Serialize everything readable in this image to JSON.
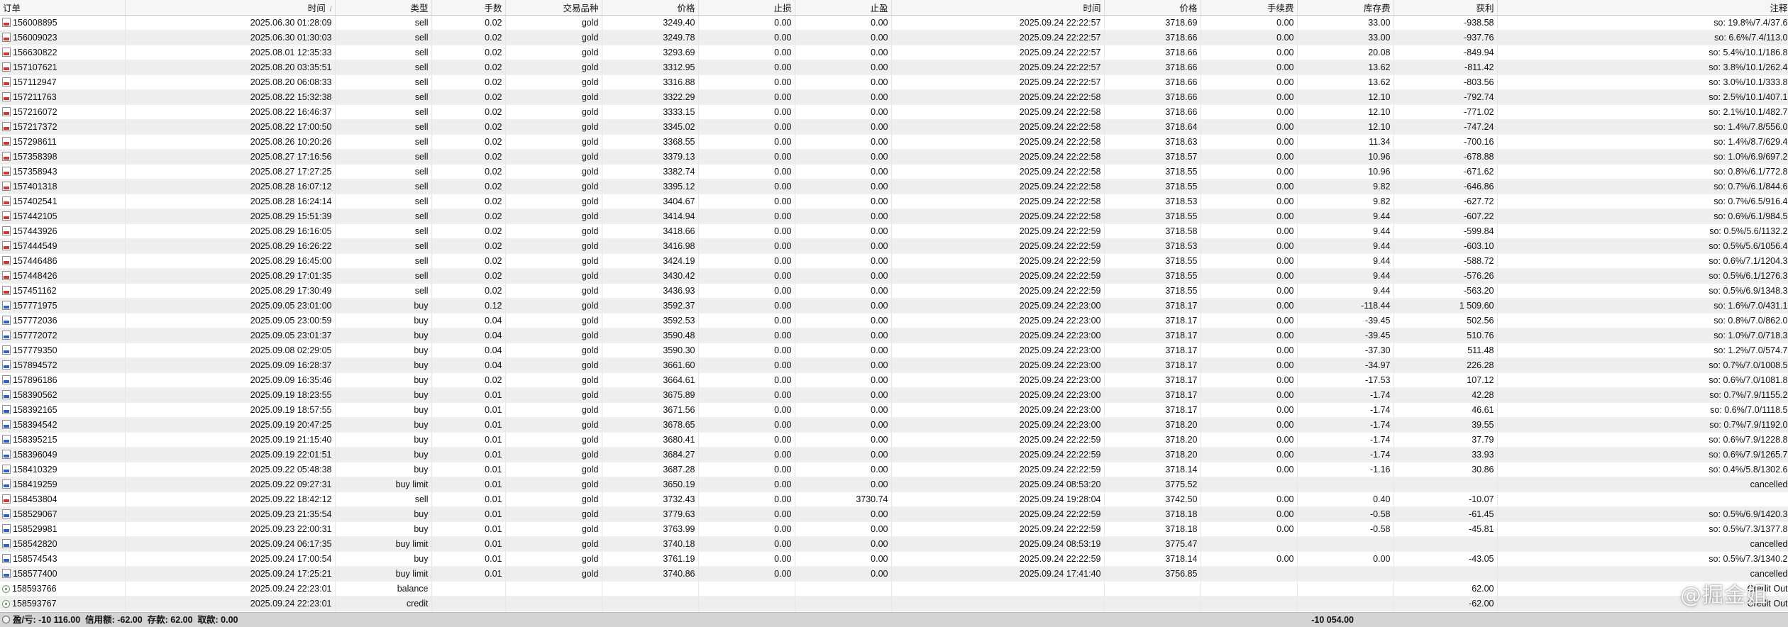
{
  "columns": [
    "订单",
    "时间",
    "类型",
    "手数",
    "交易品种",
    "价格",
    "止损",
    "止盈",
    "时间",
    "价格",
    "手续费",
    "库存费",
    "获利",
    "注释"
  ],
  "sort_indicator": "/",
  "rows": [
    {
      "icon": "sell",
      "cells": [
        "156008895",
        "2025.06.30 01:28:09",
        "sell",
        "0.02",
        "gold",
        "3249.40",
        "0.00",
        "0.00",
        "2025.09.24 22:22:57",
        "3718.69",
        "0.00",
        "33.00",
        "-938.58",
        "so: 19.8%/7.4/37.6"
      ]
    },
    {
      "icon": "sell",
      "cells": [
        "156009023",
        "2025.06.30 01:30:03",
        "sell",
        "0.02",
        "gold",
        "3249.78",
        "0.00",
        "0.00",
        "2025.09.24 22:22:57",
        "3718.66",
        "0.00",
        "33.00",
        "-937.76",
        "so: 6.6%/7.4/113.0"
      ]
    },
    {
      "icon": "sell",
      "cells": [
        "156630822",
        "2025.08.01 12:35:33",
        "sell",
        "0.02",
        "gold",
        "3293.69",
        "0.00",
        "0.00",
        "2025.09.24 22:22:57",
        "3718.66",
        "0.00",
        "20.08",
        "-849.94",
        "so: 5.4%/10.1/186.8"
      ]
    },
    {
      "icon": "sell",
      "cells": [
        "157107621",
        "2025.08.20 03:35:51",
        "sell",
        "0.02",
        "gold",
        "3312.95",
        "0.00",
        "0.00",
        "2025.09.24 22:22:57",
        "3718.66",
        "0.00",
        "13.62",
        "-811.42",
        "so: 3.8%/10.1/262.4"
      ]
    },
    {
      "icon": "sell",
      "cells": [
        "157112947",
        "2025.08.20 06:08:33",
        "sell",
        "0.02",
        "gold",
        "3316.88",
        "0.00",
        "0.00",
        "2025.09.24 22:22:57",
        "3718.66",
        "0.00",
        "13.62",
        "-803.56",
        "so: 3.0%/10.1/333.8"
      ]
    },
    {
      "icon": "sell",
      "cells": [
        "157211763",
        "2025.08.22 15:32:38",
        "sell",
        "0.02",
        "gold",
        "3322.29",
        "0.00",
        "0.00",
        "2025.09.24 22:22:58",
        "3718.66",
        "0.00",
        "12.10",
        "-792.74",
        "so: 2.5%/10.1/407.1"
      ]
    },
    {
      "icon": "sell",
      "cells": [
        "157216072",
        "2025.08.22 16:46:37",
        "sell",
        "0.02",
        "gold",
        "3333.15",
        "0.00",
        "0.00",
        "2025.09.24 22:22:58",
        "3718.66",
        "0.00",
        "12.10",
        "-771.02",
        "so: 2.1%/10.1/482.7"
      ]
    },
    {
      "icon": "sell",
      "cells": [
        "157217372",
        "2025.08.22 17:00:50",
        "sell",
        "0.02",
        "gold",
        "3345.02",
        "0.00",
        "0.00",
        "2025.09.24 22:22:58",
        "3718.64",
        "0.00",
        "12.10",
        "-747.24",
        "so: 1.4%/7.8/556.0"
      ]
    },
    {
      "icon": "sell",
      "cells": [
        "157298611",
        "2025.08.26 10:20:26",
        "sell",
        "0.02",
        "gold",
        "3368.55",
        "0.00",
        "0.00",
        "2025.09.24 22:22:58",
        "3718.63",
        "0.00",
        "11.34",
        "-700.16",
        "so: 1.4%/8.7/629.4"
      ]
    },
    {
      "icon": "sell",
      "cells": [
        "157358398",
        "2025.08.27 17:16:56",
        "sell",
        "0.02",
        "gold",
        "3379.13",
        "0.00",
        "0.00",
        "2025.09.24 22:22:58",
        "3718.57",
        "0.00",
        "10.96",
        "-678.88",
        "so: 1.0%/6.9/697.2"
      ]
    },
    {
      "icon": "sell",
      "cells": [
        "157358943",
        "2025.08.27 17:27:25",
        "sell",
        "0.02",
        "gold",
        "3382.74",
        "0.00",
        "0.00",
        "2025.09.24 22:22:58",
        "3718.55",
        "0.00",
        "10.96",
        "-671.62",
        "so: 0.8%/6.1/772.8"
      ]
    },
    {
      "icon": "sell",
      "cells": [
        "157401318",
        "2025.08.28 16:07:12",
        "sell",
        "0.02",
        "gold",
        "3395.12",
        "0.00",
        "0.00",
        "2025.09.24 22:22:58",
        "3718.55",
        "0.00",
        "9.82",
        "-646.86",
        "so: 0.7%/6.1/844.6"
      ]
    },
    {
      "icon": "sell",
      "cells": [
        "157402541",
        "2025.08.28 16:24:14",
        "sell",
        "0.02",
        "gold",
        "3404.67",
        "0.00",
        "0.00",
        "2025.09.24 22:22:58",
        "3718.53",
        "0.00",
        "9.82",
        "-627.72",
        "so: 0.7%/6.5/916.4"
      ]
    },
    {
      "icon": "sell",
      "cells": [
        "157442105",
        "2025.08.29 15:51:39",
        "sell",
        "0.02",
        "gold",
        "3414.94",
        "0.00",
        "0.00",
        "2025.09.24 22:22:58",
        "3718.55",
        "0.00",
        "9.44",
        "-607.22",
        "so: 0.6%/6.1/984.5"
      ]
    },
    {
      "icon": "sell",
      "cells": [
        "157443926",
        "2025.08.29 16:16:05",
        "sell",
        "0.02",
        "gold",
        "3418.66",
        "0.00",
        "0.00",
        "2025.09.24 22:22:59",
        "3718.58",
        "0.00",
        "9.44",
        "-599.84",
        "so: 0.5%/5.6/1132.2"
      ]
    },
    {
      "icon": "sell",
      "cells": [
        "157444549",
        "2025.08.29 16:26:22",
        "sell",
        "0.02",
        "gold",
        "3416.98",
        "0.00",
        "0.00",
        "2025.09.24 22:22:59",
        "3718.53",
        "0.00",
        "9.44",
        "-603.10",
        "so: 0.5%/5.6/1056.4"
      ]
    },
    {
      "icon": "sell",
      "cells": [
        "157446486",
        "2025.08.29 16:45:00",
        "sell",
        "0.02",
        "gold",
        "3424.19",
        "0.00",
        "0.00",
        "2025.09.24 22:22:59",
        "3718.55",
        "0.00",
        "9.44",
        "-588.72",
        "so: 0.6%/7.1/1204.3"
      ]
    },
    {
      "icon": "sell",
      "cells": [
        "157448426",
        "2025.08.29 17:01:35",
        "sell",
        "0.02",
        "gold",
        "3430.42",
        "0.00",
        "0.00",
        "2025.09.24 22:22:59",
        "3718.55",
        "0.00",
        "9.44",
        "-576.26",
        "so: 0.5%/6.1/1276.3"
      ]
    },
    {
      "icon": "sell",
      "cells": [
        "157451162",
        "2025.08.29 17:30:49",
        "sell",
        "0.02",
        "gold",
        "3436.93",
        "0.00",
        "0.00",
        "2025.09.24 22:22:59",
        "3718.55",
        "0.00",
        "9.44",
        "-563.20",
        "so: 0.5%/6.9/1348.3"
      ]
    },
    {
      "icon": "buy",
      "cells": [
        "157771975",
        "2025.09.05 23:01:00",
        "buy",
        "0.12",
        "gold",
        "3592.37",
        "0.00",
        "0.00",
        "2025.09.24 22:23:00",
        "3718.17",
        "0.00",
        "-118.44",
        "1 509.60",
        "so: 1.6%/7.0/431.1"
      ]
    },
    {
      "icon": "buy",
      "cells": [
        "157772036",
        "2025.09.05 23:00:59",
        "buy",
        "0.04",
        "gold",
        "3592.53",
        "0.00",
        "0.00",
        "2025.09.24 22:23:00",
        "3718.17",
        "0.00",
        "-39.45",
        "502.56",
        "so: 0.8%/7.0/862.0"
      ]
    },
    {
      "icon": "buy",
      "cells": [
        "157772072",
        "2025.09.05 23:01:37",
        "buy",
        "0.04",
        "gold",
        "3590.48",
        "0.00",
        "0.00",
        "2025.09.24 22:23:00",
        "3718.17",
        "0.00",
        "-39.45",
        "510.76",
        "so: 1.0%/7.0/718.3"
      ]
    },
    {
      "icon": "buy",
      "cells": [
        "157779350",
        "2025.09.08 02:29:05",
        "buy",
        "0.04",
        "gold",
        "3590.30",
        "0.00",
        "0.00",
        "2025.09.24 22:23:00",
        "3718.17",
        "0.00",
        "-37.30",
        "511.48",
        "so: 1.2%/7.0/574.7"
      ]
    },
    {
      "icon": "buy",
      "cells": [
        "157894572",
        "2025.09.09 16:28:37",
        "buy",
        "0.04",
        "gold",
        "3661.60",
        "0.00",
        "0.00",
        "2025.09.24 22:23:00",
        "3718.17",
        "0.00",
        "-34.97",
        "226.28",
        "so: 0.7%/7.0/1008.5"
      ]
    },
    {
      "icon": "buy",
      "cells": [
        "157896186",
        "2025.09.09 16:35:46",
        "buy",
        "0.02",
        "gold",
        "3664.61",
        "0.00",
        "0.00",
        "2025.09.24 22:23:00",
        "3718.17",
        "0.00",
        "-17.53",
        "107.12",
        "so: 0.6%/7.0/1081.8"
      ]
    },
    {
      "icon": "buy",
      "cells": [
        "158390562",
        "2025.09.19 18:23:55",
        "buy",
        "0.01",
        "gold",
        "3675.89",
        "0.00",
        "0.00",
        "2025.09.24 22:23:00",
        "3718.17",
        "0.00",
        "-1.74",
        "42.28",
        "so: 0.7%/7.9/1155.2"
      ]
    },
    {
      "icon": "buy",
      "cells": [
        "158392165",
        "2025.09.19 18:57:55",
        "buy",
        "0.01",
        "gold",
        "3671.56",
        "0.00",
        "0.00",
        "2025.09.24 22:23:00",
        "3718.17",
        "0.00",
        "-1.74",
        "46.61",
        "so: 0.6%/7.0/1118.5"
      ]
    },
    {
      "icon": "buy",
      "cells": [
        "158394542",
        "2025.09.19 20:47:25",
        "buy",
        "0.01",
        "gold",
        "3678.65",
        "0.00",
        "0.00",
        "2025.09.24 22:23:00",
        "3718.20",
        "0.00",
        "-1.74",
        "39.55",
        "so: 0.7%/7.9/1192.0"
      ]
    },
    {
      "icon": "buy",
      "cells": [
        "158395215",
        "2025.09.19 21:15:40",
        "buy",
        "0.01",
        "gold",
        "3680.41",
        "0.00",
        "0.00",
        "2025.09.24 22:22:59",
        "3718.20",
        "0.00",
        "-1.74",
        "37.79",
        "so: 0.6%/7.9/1228.8"
      ]
    },
    {
      "icon": "buy",
      "cells": [
        "158396049",
        "2025.09.19 22:01:51",
        "buy",
        "0.01",
        "gold",
        "3684.27",
        "0.00",
        "0.00",
        "2025.09.24 22:22:59",
        "3718.20",
        "0.00",
        "-1.74",
        "33.93",
        "so: 0.6%/7.9/1265.7"
      ]
    },
    {
      "icon": "buy",
      "cells": [
        "158410329",
        "2025.09.22 05:48:38",
        "buy",
        "0.01",
        "gold",
        "3687.28",
        "0.00",
        "0.00",
        "2025.09.24 22:22:59",
        "3718.14",
        "0.00",
        "-1.16",
        "30.86",
        "so: 0.4%/5.8/1302.6"
      ]
    },
    {
      "icon": "buy",
      "cells": [
        "158419259",
        "2025.09.22 09:27:31",
        "buy limit",
        "0.01",
        "gold",
        "3650.19",
        "0.00",
        "0.00",
        "2025.09.24 08:53:20",
        "3775.52",
        "",
        "",
        "",
        "cancelled"
      ]
    },
    {
      "icon": "sell",
      "cells": [
        "158453804",
        "2025.09.22 18:42:12",
        "sell",
        "0.01",
        "gold",
        "3732.43",
        "0.00",
        "3730.74",
        "2025.09.24 19:28:04",
        "3742.50",
        "0.00",
        "0.40",
        "-10.07",
        ""
      ]
    },
    {
      "icon": "buy",
      "cells": [
        "158529067",
        "2025.09.23 21:35:54",
        "buy",
        "0.01",
        "gold",
        "3779.63",
        "0.00",
        "0.00",
        "2025.09.24 22:22:59",
        "3718.18",
        "0.00",
        "-0.58",
        "-61.45",
        "so: 0.5%/6.9/1420.3"
      ]
    },
    {
      "icon": "buy",
      "cells": [
        "158529981",
        "2025.09.23 22:00:31",
        "buy",
        "0.01",
        "gold",
        "3763.99",
        "0.00",
        "0.00",
        "2025.09.24 22:22:59",
        "3718.18",
        "0.00",
        "-0.58",
        "-45.81",
        "so: 0.5%/7.3/1377.8"
      ]
    },
    {
      "icon": "buy",
      "cells": [
        "158542820",
        "2025.09.24 06:17:35",
        "buy limit",
        "0.01",
        "gold",
        "3740.18",
        "0.00",
        "0.00",
        "2025.09.24 08:53:19",
        "3775.47",
        "",
        "",
        "",
        "cancelled"
      ]
    },
    {
      "icon": "buy",
      "cells": [
        "158574543",
        "2025.09.24 17:00:54",
        "buy",
        "0.01",
        "gold",
        "3761.19",
        "0.00",
        "0.00",
        "2025.09.24 22:22:59",
        "3718.14",
        "0.00",
        "0.00",
        "-43.05",
        "so: 0.5%/7.3/1340.2"
      ]
    },
    {
      "icon": "buy",
      "cells": [
        "158577400",
        "2025.09.24 17:25:21",
        "buy limit",
        "0.01",
        "gold",
        "3740.86",
        "0.00",
        "0.00",
        "2025.09.24 17:41:40",
        "3756.85",
        "",
        "",
        "",
        "cancelled"
      ]
    },
    {
      "icon": "op",
      "cells": [
        "158593766",
        "2025.09.24 22:23:01",
        "balance",
        "",
        "",
        "",
        "",
        "",
        "",
        "",
        "",
        "",
        "62.00",
        "Credit Out"
      ]
    },
    {
      "icon": "op",
      "cells": [
        "158593767",
        "2025.09.24 22:23:01",
        "credit",
        "",
        "",
        "",
        "",
        "",
        "",
        "",
        "",
        "",
        "-62.00",
        "Credit Out"
      ]
    }
  ],
  "footer": {
    "summary": "盈/亏: -10 116.00  信用额: -62.00  存款: 62.00  取款: 0.00",
    "total": "-10 054.00"
  },
  "watermark": "@掘金姐",
  "colors": {
    "sell_icon": "#d0342c",
    "buy_icon": "#2a63c8",
    "alt_row": "#eeeeee",
    "footer_bg": "#d4d4d4"
  }
}
